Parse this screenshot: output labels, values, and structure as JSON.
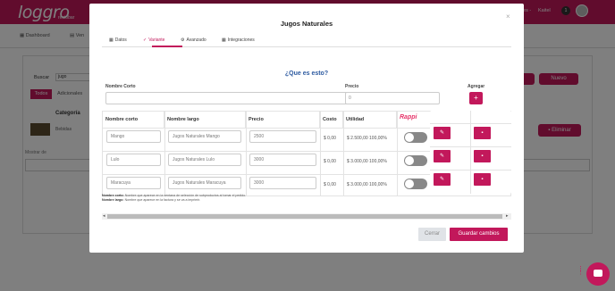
{
  "app": {
    "logo": "loggro",
    "logo_sub": "restobar",
    "user_name": "Kaitel",
    "user_menu_prefix": "nes -",
    "notification_count": "1"
  },
  "nav": {
    "items": [
      {
        "label": "Dashboard"
      },
      {
        "label": "Ven"
      }
    ]
  },
  "background": {
    "search_label": "Buscar",
    "search_value": "jugo",
    "tabs": [
      {
        "label": "Todos"
      },
      {
        "label": "Adicionales"
      }
    ],
    "category_header": "Categoría",
    "row_text": "Bebidas",
    "eliminar_label": "Eliminar",
    "nuevo_label": "Nuevo",
    "mostrar_label": "Mostrar de"
  },
  "modal": {
    "title": "Jugos Naturales",
    "close": "×",
    "tabs": [
      {
        "label": "Datos",
        "icon": "▦"
      },
      {
        "label": "Variante",
        "icon": "✓"
      },
      {
        "label": "Avanzado",
        "icon": "⚙"
      },
      {
        "label": "Integraciones",
        "icon": "▦"
      }
    ],
    "que_es_esto": "¿Que es esto?",
    "form": {
      "nombre_corto_label": "Nombre Corto",
      "nombre_corto_value": "",
      "precio_label": "Precio",
      "precio_value": "0",
      "agregar_label": "Agregar",
      "agregar_icon": "+"
    },
    "table": {
      "headers": [
        "Nombre corto",
        "Nombre largo",
        "Precio",
        "Costo",
        "Utilidad",
        "Rappi"
      ],
      "rows": [
        {
          "corto": "Mango",
          "largo": "Jugos Naturales Mango",
          "precio": "2500",
          "costo": "$ 0,00",
          "utilidad": "$ 2.500,00 100,00%"
        },
        {
          "corto": "Lulo",
          "largo": "Jugos Naturales Lulo",
          "precio": "3000",
          "costo": "$ 0,00",
          "utilidad": "$ 3.000,00 100,00%"
        },
        {
          "corto": "Maracuya",
          "largo": "Jugos Naturales Maracuya",
          "precio": "3000",
          "costo": "$ 0,00",
          "utilidad": "$ 3.000,00 100,00%"
        }
      ]
    },
    "notes": {
      "corto_bold": "Nombre corto:",
      "corto_text": "Nombre que aparece en la ventana de selección de subproductos al tomar el pedido.",
      "largo_bold": "Nombre largo:",
      "largo_text": "Nombre que aparece en la factura y se va a imprimir."
    },
    "cerrar_label": "Cerrar",
    "guardar_label": "Guardar cambios"
  },
  "colors": {
    "brand": "#c2185b",
    "link": "#2c5aa0"
  }
}
